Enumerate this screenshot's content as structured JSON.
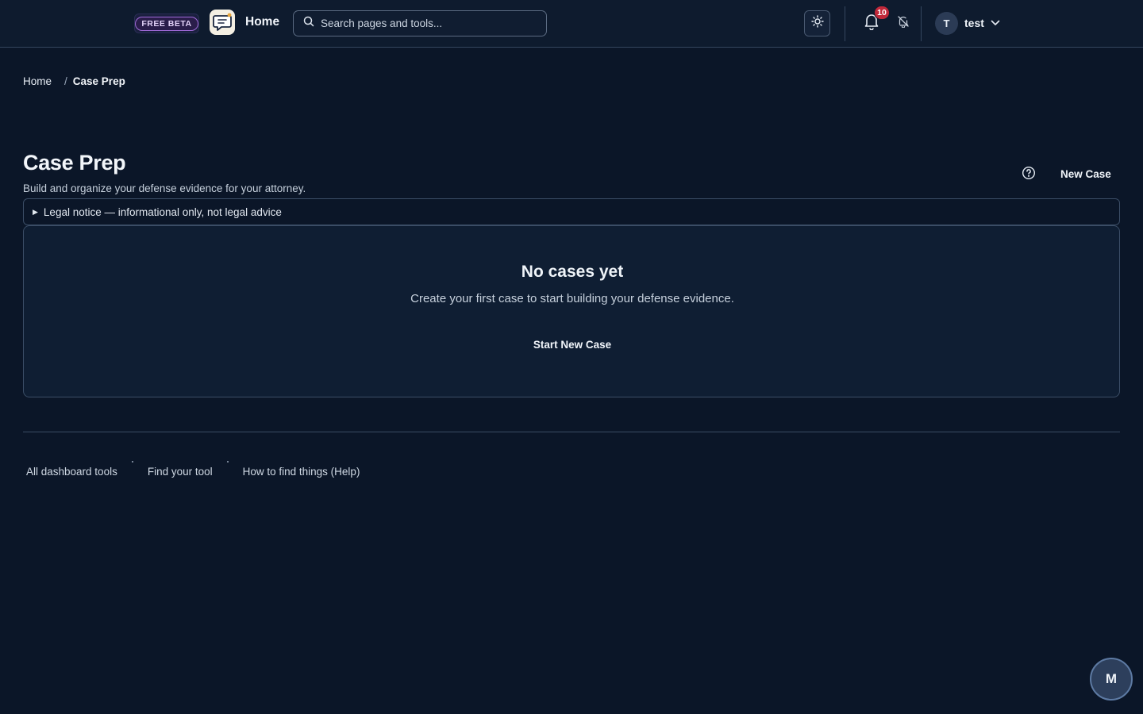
{
  "header": {
    "beta_badge": "FREE BETA",
    "home_label": "Home",
    "search_placeholder": "Search pages and tools...",
    "notification_count": "10",
    "user": {
      "initial": "T",
      "name": "test"
    }
  },
  "breadcrumb": {
    "home": "Home",
    "separator": "/",
    "current": "Case Prep"
  },
  "page": {
    "title": "Case Prep",
    "subtitle": "Build and organize your defense evidence for your attorney.",
    "new_case_label": "New Case",
    "legal_notice": "Legal notice — informational only, not legal advice"
  },
  "empty_state": {
    "title": "No cases yet",
    "description": "Create your first case to start building your defense evidence.",
    "button_label": "Start New Case"
  },
  "footer": {
    "links": [
      "All dashboard tools",
      "Find your tool",
      "How to find things (Help)"
    ]
  },
  "fab": {
    "label": "M"
  },
  "colors": {
    "background": "#0b1628",
    "header": "#0e1b2e",
    "badge_red": "#c0283a",
    "beta_purple": "#a06ad8"
  },
  "icons": [
    "chat-logo-icon",
    "search-icon",
    "sun-icon",
    "bell-icon",
    "bell-off-icon",
    "chevron-down-icon",
    "help-circle-icon",
    "triangle-right-icon"
  ]
}
